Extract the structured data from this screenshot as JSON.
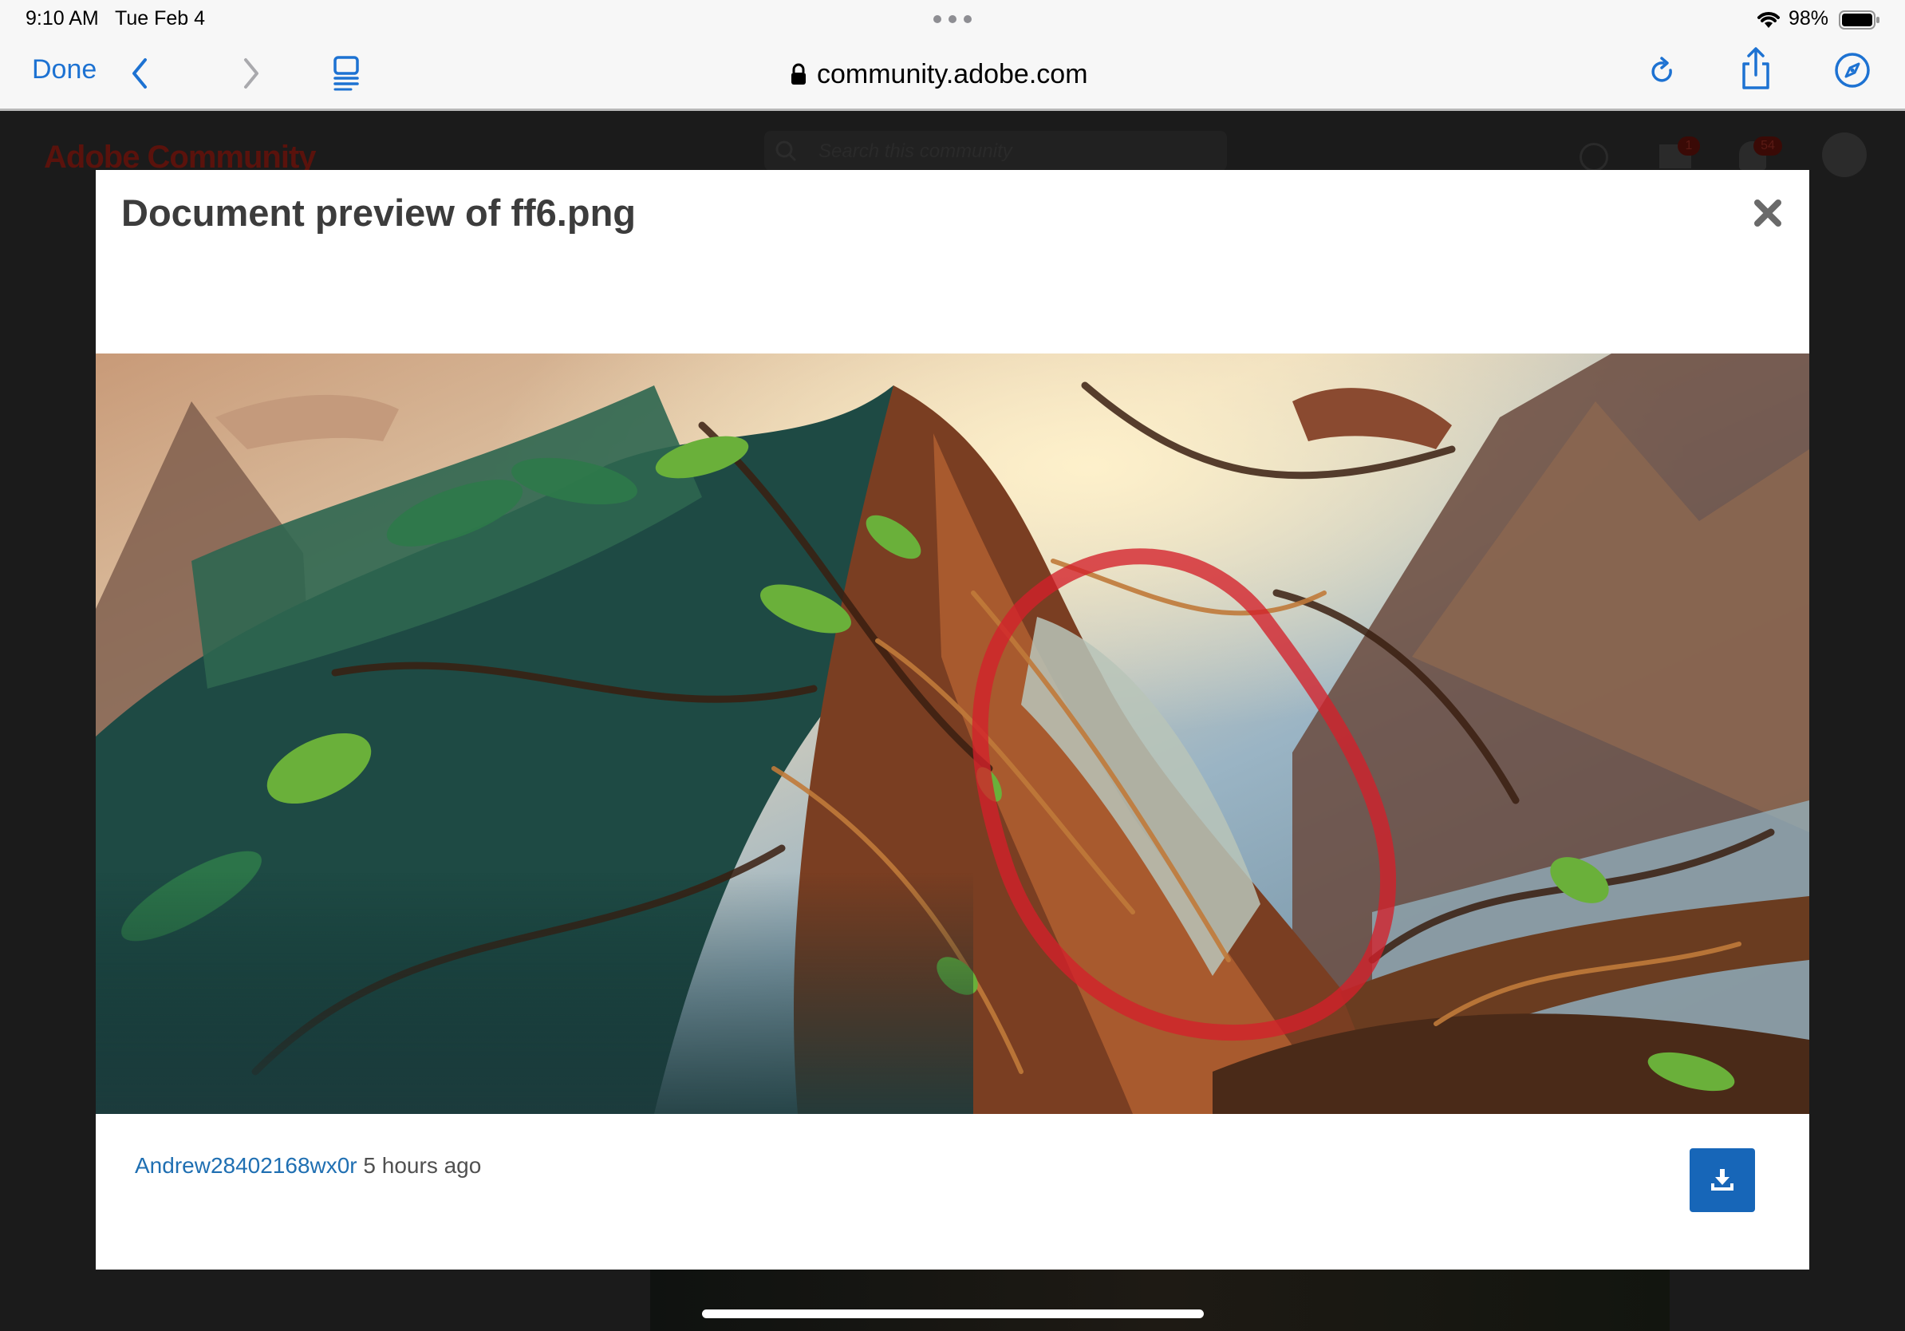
{
  "status_bar": {
    "time": "9:10 AM",
    "date": "Tue Feb 4",
    "battery": "98%"
  },
  "browser": {
    "done_label": "Done",
    "url": "community.adobe.com",
    "accent_color": "#1d72d2"
  },
  "background_page": {
    "brand": "Adobe Community",
    "search_placeholder": "Search this community",
    "mail_badge": "1",
    "notification_badge": "54"
  },
  "modal": {
    "title": "Document preview of ff6.png",
    "author": "Andrew28402168wx0r",
    "timestamp": "5 hours ago",
    "download_color": "#1766b8"
  }
}
